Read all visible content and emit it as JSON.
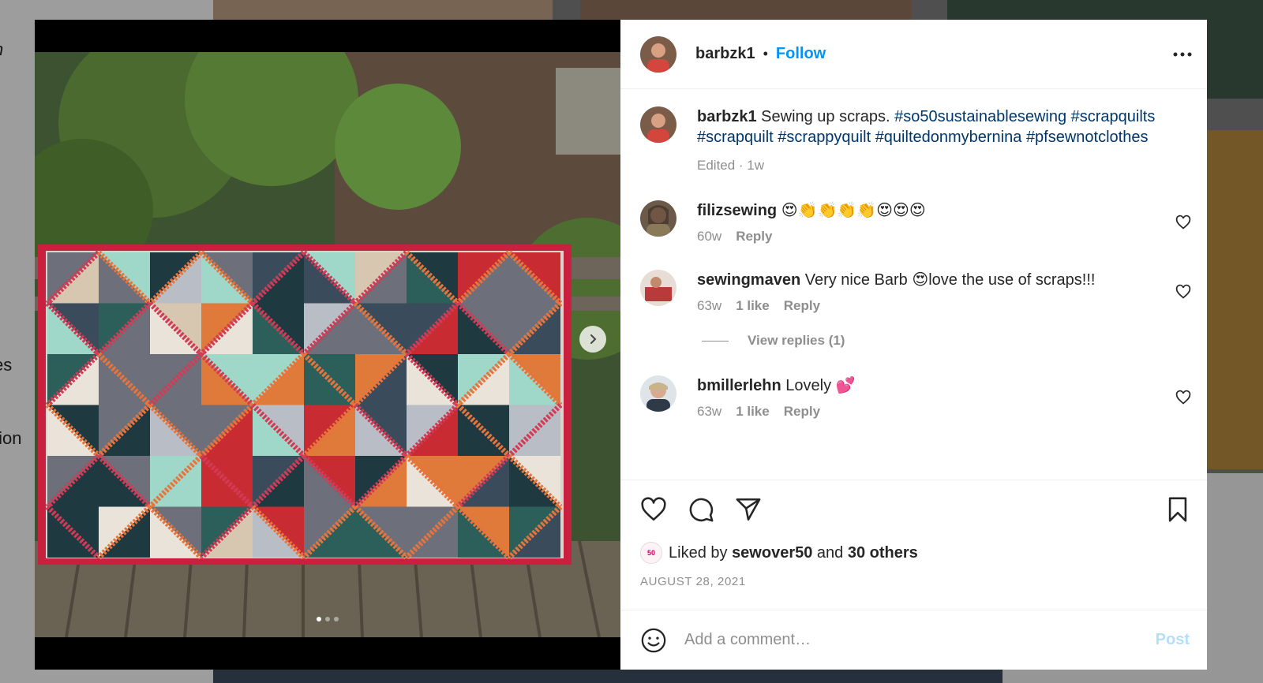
{
  "background": {
    "side_text_1": "n",
    "side_text_2": "es",
    "side_text_3": "tion"
  },
  "media": {
    "next_icon": "chevron-right-icon",
    "carousel_total": 3,
    "carousel_active": 1
  },
  "header": {
    "username": "barbzk1",
    "separator": "•",
    "follow_label": "Follow",
    "more_icon": "more-horizontal-icon"
  },
  "caption": {
    "username": "barbzk1",
    "text": "Sewing up scraps.",
    "hashtags": [
      "#so50sustainablesewing",
      "#scrapquilts",
      "#scrapquilt",
      "#scrappyquilt",
      "#quiltedonmybernina",
      "#pfsewnotclothes"
    ],
    "meta": "Edited · 1w"
  },
  "comments": [
    {
      "username": "filizsewing",
      "text": "😍👏👏👏👏😍😍😍",
      "age": "60w",
      "likes": "",
      "reply_label": "Reply"
    },
    {
      "username": "sewingmaven",
      "text": "Very nice Barb 😍love the use of scraps!!!",
      "age": "63w",
      "likes": "1 like",
      "reply_label": "Reply"
    },
    {
      "username": "bmillerlehn",
      "text": "Lovely 💕",
      "age": "63w",
      "likes": "1 like",
      "reply_label": "Reply"
    }
  ],
  "view_replies": "View replies (1)",
  "actions": {
    "like_icon": "heart-icon",
    "comment_icon": "comment-icon",
    "share_icon": "share-icon",
    "save_icon": "bookmark-icon"
  },
  "likes": {
    "avatar_text": "50",
    "prefix": "Liked by",
    "user": "sewover50",
    "middle": "and",
    "others": "30 others"
  },
  "date": "AUGUST 28, 2021",
  "add_comment": {
    "placeholder": "Add a comment…",
    "post_label": "Post",
    "emoji_icon": "smiley-icon"
  },
  "colors": {
    "follow_blue": "#0095f6",
    "hashtag_blue": "#00376b",
    "post_disabled": "#b2dffc",
    "muted": "#8e8e8e"
  }
}
